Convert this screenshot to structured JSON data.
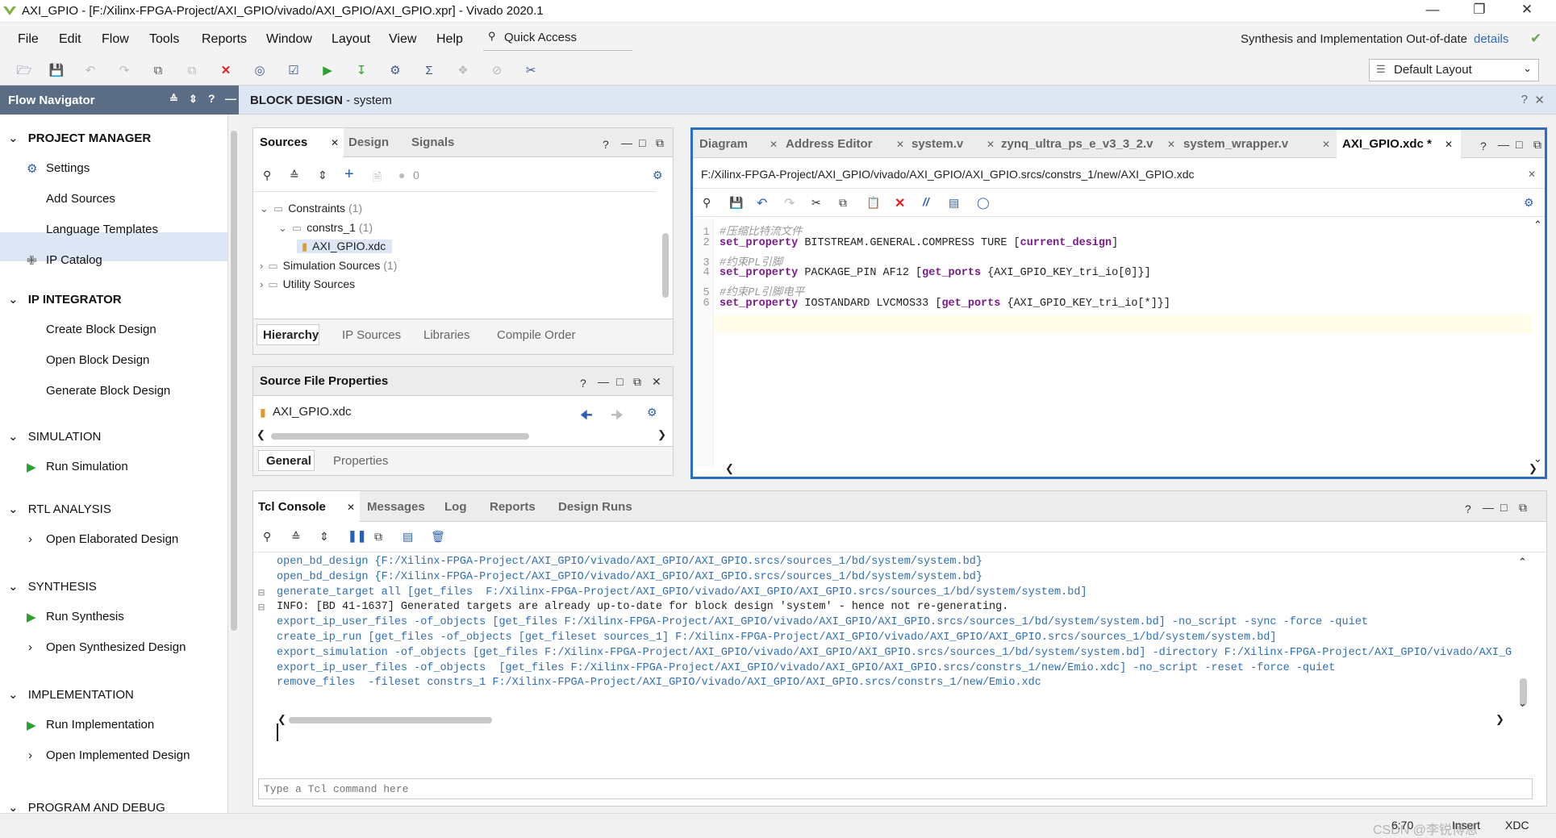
{
  "window": {
    "title": "AXI_GPIO - [F:/Xilinx-FPGA-Project/AXI_GPIO/vivado/AXI_GPIO/AXI_GPIO.xpr] - Vivado 2020.1"
  },
  "menu": [
    "File",
    "Edit",
    "Flow",
    "Tools",
    "Reports",
    "Window",
    "Layout",
    "View",
    "Help"
  ],
  "quick_access": "Quick Access",
  "status_right": {
    "text": "Synthesis and Implementation Out-of-date",
    "link": "details"
  },
  "layout_select": "Default Layout",
  "flow_nav": {
    "title": "Flow Navigator",
    "sections": [
      {
        "label": "PROJECT MANAGER",
        "items": [
          "Settings",
          "Add Sources",
          "Language Templates",
          "IP Catalog"
        ]
      },
      {
        "label": "IP INTEGRATOR",
        "items": [
          "Create Block Design",
          "Open Block Design",
          "Generate Block Design"
        ]
      },
      {
        "label": "SIMULATION",
        "items": [
          "Run Simulation"
        ]
      },
      {
        "label": "RTL ANALYSIS",
        "items": [
          "Open Elaborated Design"
        ]
      },
      {
        "label": "SYNTHESIS",
        "items": [
          "Run Synthesis",
          "Open Synthesized Design"
        ]
      },
      {
        "label": "IMPLEMENTATION",
        "items": [
          "Run Implementation",
          "Open Implemented Design"
        ]
      },
      {
        "label": "PROGRAM AND DEBUG",
        "items": []
      }
    ]
  },
  "block_design": {
    "title": "BLOCK DESIGN",
    "subtitle": " - system"
  },
  "sources": {
    "tabs": [
      "Sources",
      "Design",
      "Signals"
    ],
    "badge": "0",
    "tree": [
      {
        "label": "Constraints",
        "count": "(1)",
        "level": 0
      },
      {
        "label": "constrs_1",
        "count": "(1)",
        "level": 1
      },
      {
        "label": "AXI_GPIO.xdc",
        "count": "",
        "level": 2
      },
      {
        "label": "Simulation Sources",
        "count": "(1)",
        "level": 0
      },
      {
        "label": "Utility Sources",
        "count": "",
        "level": 0
      }
    ],
    "bottom_tabs": [
      "Hierarchy",
      "IP Sources",
      "Libraries",
      "Compile Order"
    ]
  },
  "props": {
    "title": "Source File Properties",
    "file": "AXI_GPIO.xdc",
    "tabs": [
      "General",
      "Properties"
    ]
  },
  "editor": {
    "tabs": [
      "Diagram",
      "Address Editor",
      "system.v",
      "zynq_ultra_ps_e_v3_3_2.v",
      "system_wrapper.v",
      "AXI_GPIO.xdc *"
    ],
    "path": "F:/Xilinx-FPGA-Project/AXI_GPIO/vivado/AXI_GPIO/AXI_GPIO.srcs/constrs_1/new/AXI_GPIO.xdc",
    "lines": [
      {
        "n": "1",
        "kw": "",
        "rest": "",
        "comment": "#压缩比特流文件"
      },
      {
        "n": "2",
        "kw": "set_property",
        "rest": " BITSTREAM.GENERAL.COMPRESS TURE [",
        "kw2": "current_design",
        "tail": "]",
        "comment": ""
      },
      {
        "n": "3",
        "kw": "",
        "rest": "",
        "comment": "#约束PL引脚"
      },
      {
        "n": "4",
        "kw": "set_property",
        "rest": " PACKAGE_PIN AF12 [",
        "kw2": "get_ports",
        "tail": " {AXI_GPIO_KEY_tri_io[0]}]",
        "comment": ""
      },
      {
        "n": "5",
        "kw": "",
        "rest": "",
        "comment": "#约束PL引脚电平"
      },
      {
        "n": "6",
        "kw": "set_property",
        "rest": " IOSTANDARD LVCMOS33 [",
        "kw2": "get_ports",
        "tail": " {AXI_GPIO_KEY_tri_io[*]}]",
        "comment": ""
      }
    ]
  },
  "console": {
    "tabs": [
      "Tcl Console",
      "Messages",
      "Log",
      "Reports",
      "Design Runs"
    ],
    "lines": [
      {
        "text": "open_bd_design {F:/Xilinx-FPGA-Project/AXI_GPIO/vivado/AXI_GPIO/AXI_GPIO.srcs/sources_1/bd/system/system.bd}",
        "type": "cmd"
      },
      {
        "text": "open_bd_design {F:/Xilinx-FPGA-Project/AXI_GPIO/vivado/AXI_GPIO/AXI_GPIO.srcs/sources_1/bd/system/system.bd}",
        "type": "cmd"
      },
      {
        "text": "generate_target all [get_files  F:/Xilinx-FPGA-Project/AXI_GPIO/vivado/AXI_GPIO/AXI_GPIO.srcs/sources_1/bd/system/system.bd]",
        "type": "cmd"
      },
      {
        "text": "INFO: [BD 41-1637] Generated targets are already up-to-date for block design 'system' - hence not re-generating.",
        "type": "info"
      },
      {
        "text": "export_ip_user_files -of_objects [get_files F:/Xilinx-FPGA-Project/AXI_GPIO/vivado/AXI_GPIO/AXI_GPIO.srcs/sources_1/bd/system/system.bd] -no_script -sync -force -quiet",
        "type": "cmd"
      },
      {
        "text": "create_ip_run [get_files -of_objects [get_fileset sources_1] F:/Xilinx-FPGA-Project/AXI_GPIO/vivado/AXI_GPIO/AXI_GPIO.srcs/sources_1/bd/system/system.bd]",
        "type": "cmd"
      },
      {
        "text": "export_simulation -of_objects [get_files F:/Xilinx-FPGA-Project/AXI_GPIO/vivado/AXI_GPIO/AXI_GPIO.srcs/sources_1/bd/system/system.bd] -directory F:/Xilinx-FPGA-Project/AXI_GPIO/vivado/AXI_GPI",
        "type": "cmd"
      },
      {
        "text": "export_ip_user_files -of_objects  [get_files F:/Xilinx-FPGA-Project/AXI_GPIO/vivado/AXI_GPIO/AXI_GPIO.srcs/constrs_1/new/Emio.xdc] -no_script -reset -force -quiet",
        "type": "cmd"
      },
      {
        "text": "remove_files  -fileset constrs_1 F:/Xilinx-FPGA-Project/AXI_GPIO/vivado/AXI_GPIO/AXI_GPIO.srcs/constrs_1/new/Emio.xdc",
        "type": "cmd"
      }
    ],
    "input_placeholder": "Type a Tcl command here"
  },
  "statusbar": {
    "pos": "6:70",
    "mode": "Insert",
    "type": "XDC",
    "watermark": "CSDN @李锐博恩"
  },
  "colors": {
    "nav_header": "#5a6d84",
    "accent": "#2b5fb3",
    "keyword": "#7a1b8c",
    "tcl": "#2f6fb5"
  }
}
